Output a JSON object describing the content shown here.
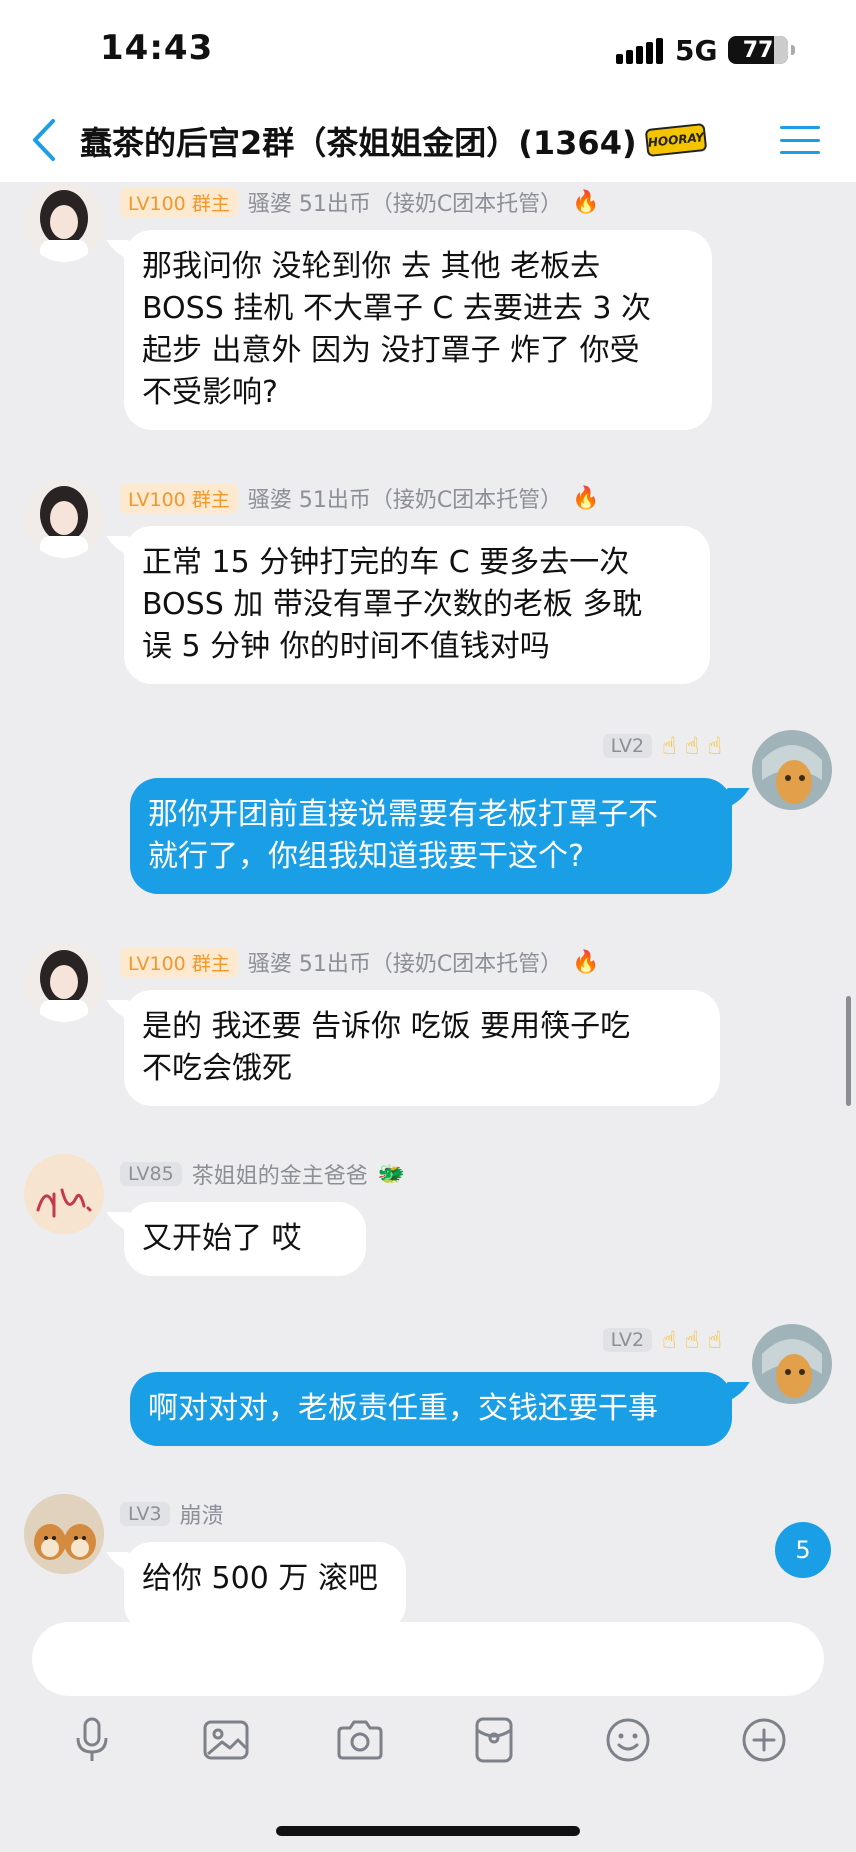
{
  "status_bar": {
    "time": "14:43",
    "network": "5G",
    "battery": "77"
  },
  "header": {
    "title": "蠢茶的后宫2群（茶姐姐金团）(1364)",
    "badge_text": "HOORAY"
  },
  "messages": [
    {
      "side": "in",
      "level": "LV100",
      "role": "群主",
      "name": "骚婆 51出币（接奶C团本托管）",
      "lines": [
        "那我问你  没轮到你  去  其他 老板去",
        "BOSS 挂机 不大罩子  C 去要进去 3 次",
        "起步 出意外 因为 没打罩子 炸了 你受",
        "不受影响?"
      ]
    },
    {
      "side": "in",
      "level": "LV100",
      "role": "群主",
      "name": "骚婆 51出币（接奶C团本托管）",
      "lines": [
        "正常 15 分钟打完的车 C 要多去一次",
        "BOSS 加 带没有罩子次数的老板 多耽",
        "误 5 分钟 你的时间不值钱对吗"
      ]
    },
    {
      "side": "out",
      "level": "LV2",
      "lines": [
        "那你开团前直接说需要有老板打罩子不",
        "就行了，你组我知道我要干这个?"
      ]
    },
    {
      "side": "in",
      "level": "LV100",
      "role": "群主",
      "name": "骚婆 51出币（接奶C团本托管）",
      "lines": [
        "是的 我还要 告诉你  吃饭 要用筷子吃",
        "不吃会饿死"
      ]
    },
    {
      "side": "in",
      "level": "LV85",
      "name": "茶姐姐的金主爸爸",
      "lines": [
        "又开始了   哎"
      ]
    },
    {
      "side": "out",
      "level": "LV2",
      "lines": [
        "啊对对对，老板责任重，交钱还要干事"
      ]
    },
    {
      "side": "in",
      "level": "LV3",
      "name": "崩溃",
      "lines": [
        "给你 500 万  滚吧"
      ]
    }
  ],
  "unread_count": "5",
  "toolbar_icons": [
    "microphone-icon",
    "image-icon",
    "camera-icon",
    "red-packet-icon",
    "emoji-icon",
    "plus-icon"
  ],
  "colors": {
    "accent": "#1a9fe6",
    "background": "#ededf0",
    "owner_badge": "#f0982b"
  }
}
